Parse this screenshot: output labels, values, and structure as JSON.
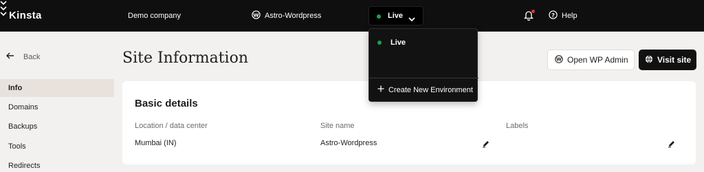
{
  "topbar": {
    "logo": "Kinsta",
    "company": "Demo company",
    "site": "Astro-Wordpress",
    "environment": "Live",
    "help": "Help"
  },
  "dropdown": {
    "items": [
      {
        "label": "Live"
      }
    ],
    "create_label": "Create New Environment"
  },
  "sidebar": {
    "back_label": "Back",
    "items": [
      {
        "label": "Info",
        "active": true
      },
      {
        "label": "Domains"
      },
      {
        "label": "Backups"
      },
      {
        "label": "Tools"
      },
      {
        "label": "Redirects"
      }
    ]
  },
  "main": {
    "title": "Site Information",
    "open_wp_admin": "Open WP Admin",
    "visit_site": "Visit site",
    "card": {
      "title": "Basic details",
      "fields": [
        {
          "label": "Location / data center",
          "value": "Mumbai (IN)"
        },
        {
          "label": "Site name",
          "value": "Astro-Wordpress"
        },
        {
          "label": "Labels",
          "value": ""
        }
      ]
    }
  },
  "colors": {
    "topbar_bg": "#0f0f0f",
    "status_green": "#1aa34a",
    "notification_red": "#e5322d",
    "page_bg": "#f3f1ef"
  }
}
